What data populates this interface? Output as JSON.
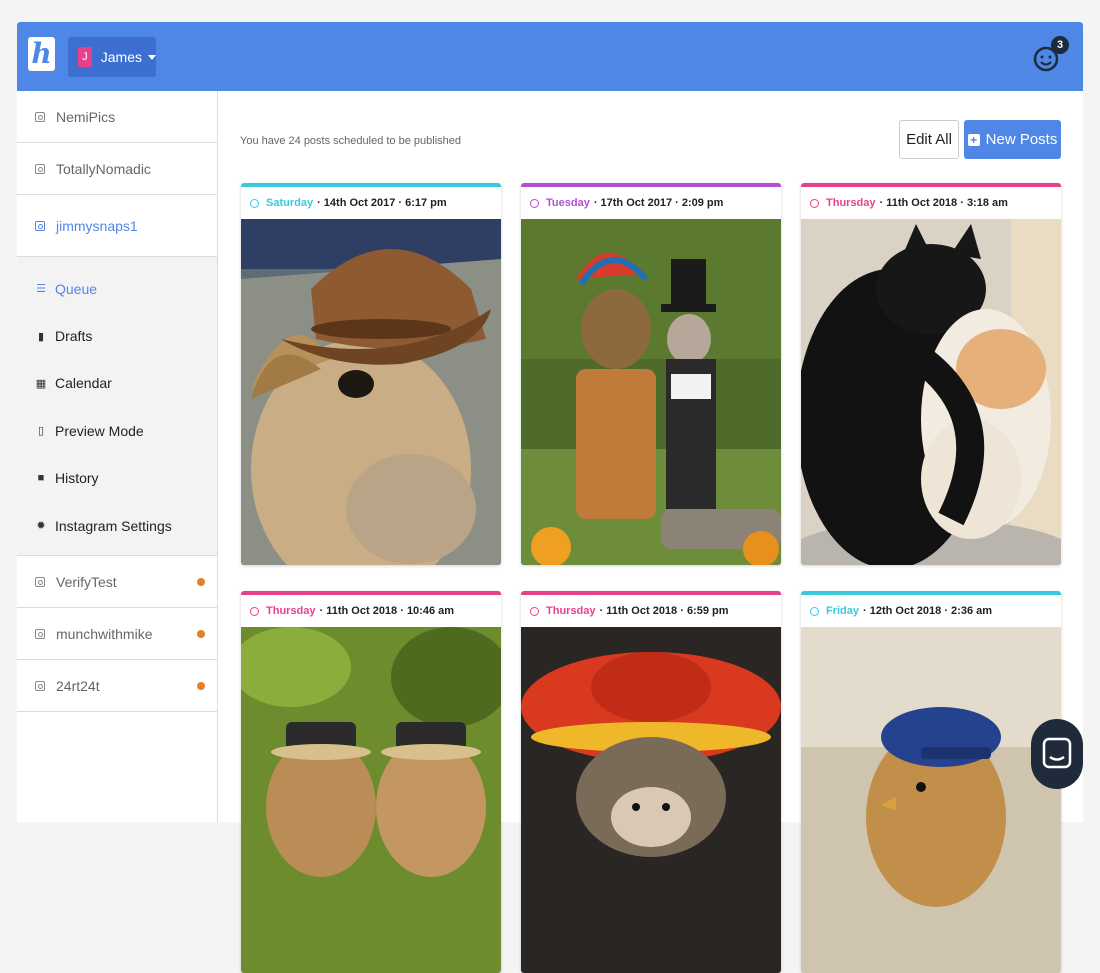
{
  "header": {
    "logo_letter": "h",
    "user_initial": "J",
    "user_name": "James",
    "notification_count": "3"
  },
  "sidebar": {
    "accounts_top": [
      {
        "label": "NemiPics"
      },
      {
        "label": "TotallyNomadic"
      },
      {
        "label": "jimmysnaps1"
      }
    ],
    "submenu": [
      {
        "label": "Queue",
        "icon": "list-icon",
        "glyph": "☰"
      },
      {
        "label": "Drafts",
        "icon": "bookmark-icon",
        "glyph": "▮"
      },
      {
        "label": "Calendar",
        "icon": "calendar-icon",
        "glyph": "▦"
      },
      {
        "label": "Preview Mode",
        "icon": "mobile-icon",
        "glyph": "▯"
      },
      {
        "label": "History",
        "icon": "history-icon",
        "glyph": "■"
      },
      {
        "label": "Instagram Settings",
        "icon": "gear-icon",
        "glyph": "✹"
      }
    ],
    "accounts_bottom": [
      {
        "label": "VerifyTest"
      },
      {
        "label": "munchwithmike"
      },
      {
        "label": "24rt24t"
      }
    ]
  },
  "main": {
    "status_text": "You have 24 posts scheduled to be published",
    "edit_all_label": "Edit All",
    "new_posts_label": "New Posts",
    "posts": [
      {
        "day": "Saturday",
        "datetime": "· 14th Oct 2017 · 6:17 pm",
        "accent": "#3ac8dc",
        "photo": "giraffe in a cowboy hat"
      },
      {
        "day": "Tuesday",
        "datetime": "· 17th Oct 2017 · 2:09 pm",
        "accent": "#b24fd6",
        "photo": "dog and cat in costumes"
      },
      {
        "day": "Thursday",
        "datetime": "· 11th Oct 2018 · 3:18 am",
        "accent": "#e8418c",
        "photo": "two cats hugging"
      },
      {
        "day": "Thursday",
        "datetime": "· 11th Oct 2018 · 10:46 am",
        "accent": "#e8418c",
        "photo": "guinea pigs in hats"
      },
      {
        "day": "Thursday",
        "datetime": "· 11th Oct 2018 · 6:59 pm",
        "accent": "#e8418c",
        "photo": "hedgehog in a sombrero"
      },
      {
        "day": "Friday",
        "datetime": "· 12th Oct 2018 · 2:36 am",
        "accent": "#3ac8dc",
        "photo": "chick in a blue cap"
      }
    ]
  },
  "colors": {
    "brand": "#4f87e6",
    "dot": "#e67e22"
  }
}
